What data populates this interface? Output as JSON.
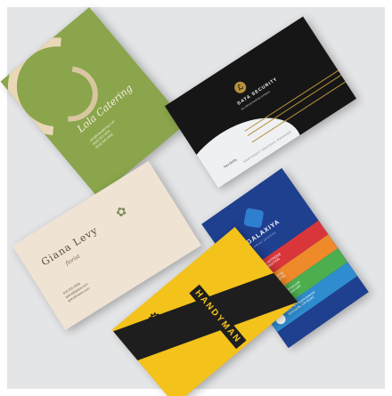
{
  "scene": {
    "description_none": "",
    "green_card": {
      "name": "Lola Catering",
      "info": "info@lolacatering.com\n(818) 555-3958\n(818) 555-3958"
    },
    "black_card": {
      "brand": "DATA SECURITY",
      "tagline": "the ethical hacking company",
      "contact": "Tom Derby",
      "role": "NORTHEAST REGIONAL MANAGER"
    },
    "cream_card": {
      "name": "Giana Levy",
      "title": "florist",
      "info": "818 555 8284\ngiana@giana.com\ngianaflowers.com"
    },
    "blue_card": {
      "brand": "GALAXIYA",
      "sub": "PRINT DESIGNS",
      "rows": [
        "JOHN CARTRIDGE\nCEO DIRECTOR",
        "818 555 8790\n818 555 8790",
        "john@galaxiya.com\nwww.galaxiya.com",
        "9132 W Powers Avenue\nSpringville, CA 91342"
      ]
    },
    "yellow_card": {
      "title": "HANDYMAN"
    }
  }
}
